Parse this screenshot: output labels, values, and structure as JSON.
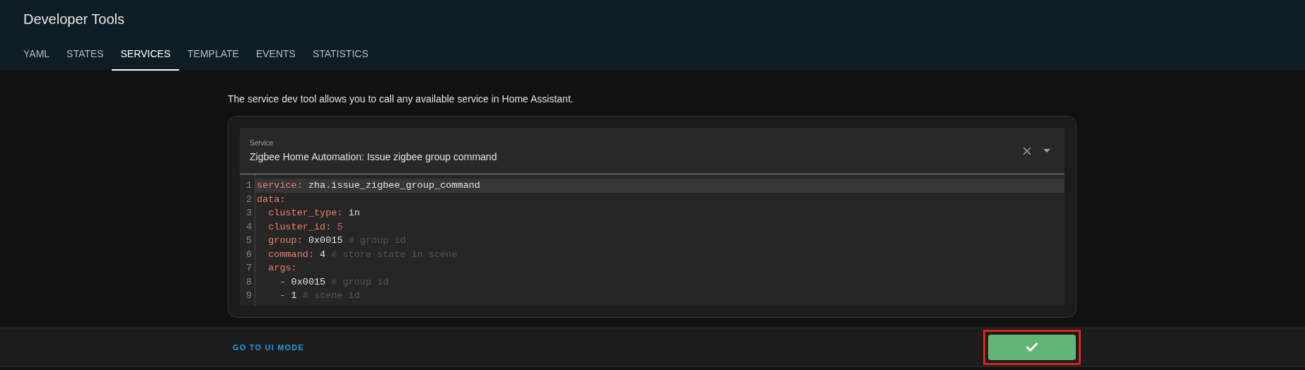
{
  "header": {
    "title": "Developer Tools"
  },
  "tabs": [
    {
      "label": "YAML",
      "selected": false
    },
    {
      "label": "STATES",
      "selected": false
    },
    {
      "label": "SERVICES",
      "selected": true
    },
    {
      "label": "TEMPLATE",
      "selected": false
    },
    {
      "label": "EVENTS",
      "selected": false
    },
    {
      "label": "STATISTICS",
      "selected": false
    }
  ],
  "description": "The service dev tool allows you to call any available service in Home Assistant.",
  "service_field": {
    "label": "Service",
    "value": "Zigbee Home Automation: Issue zigbee group command"
  },
  "editor": {
    "lines": [
      {
        "number": "1",
        "active": true,
        "segments": [
          {
            "kind": "key",
            "text": "service:"
          },
          {
            "kind": "value",
            "text": " zha.issue_zigbee_group_command"
          }
        ]
      },
      {
        "number": "2",
        "active": false,
        "segments": [
          {
            "kind": "key",
            "text": "data:"
          }
        ]
      },
      {
        "number": "3",
        "active": false,
        "segments": [
          {
            "kind": "key",
            "text": "  cluster_type:"
          },
          {
            "kind": "value",
            "text": " in"
          }
        ]
      },
      {
        "number": "4",
        "active": false,
        "segments": [
          {
            "kind": "key",
            "text": "  cluster_id:"
          },
          {
            "kind": "number",
            "text": " 5"
          }
        ]
      },
      {
        "number": "5",
        "active": false,
        "segments": [
          {
            "kind": "key",
            "text": "  group:"
          },
          {
            "kind": "value",
            "text": " 0x0015"
          },
          {
            "kind": "comment",
            "text": " # group id"
          }
        ]
      },
      {
        "number": "6",
        "active": false,
        "segments": [
          {
            "kind": "key",
            "text": "  command:"
          },
          {
            "kind": "value",
            "text": " 4"
          },
          {
            "kind": "comment",
            "text": " # store state in scene"
          }
        ]
      },
      {
        "number": "7",
        "active": false,
        "segments": [
          {
            "kind": "key",
            "text": "  args:"
          }
        ]
      },
      {
        "number": "8",
        "active": false,
        "segments": [
          {
            "kind": "dash",
            "text": "    -"
          },
          {
            "kind": "value",
            "text": " 0x0015"
          },
          {
            "kind": "comment",
            "text": " # group id"
          }
        ]
      },
      {
        "number": "9",
        "active": false,
        "segments": [
          {
            "kind": "dash",
            "text": "    -"
          },
          {
            "kind": "value",
            "text": " 1"
          },
          {
            "kind": "comment",
            "text": " # scene id"
          }
        ]
      }
    ]
  },
  "footer": {
    "link": "GO TO UI MODE",
    "call_button": {
      "highlighted": true
    }
  }
}
